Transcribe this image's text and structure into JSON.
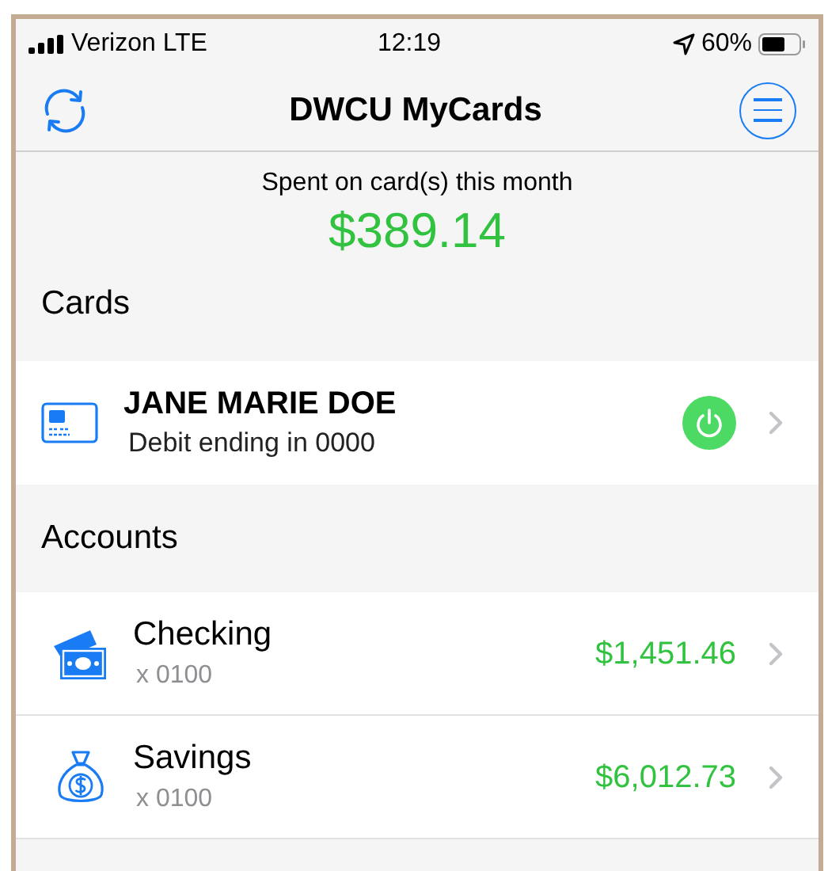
{
  "status_bar": {
    "carrier": "Verizon LTE",
    "time": "12:19",
    "battery": "60%"
  },
  "nav": {
    "title": "DWCU MyCards"
  },
  "summary": {
    "label": "Spent on card(s) this month",
    "amount": "$389.14"
  },
  "cards_section": {
    "title": "Cards",
    "cards": [
      {
        "name": "JANE MARIE DOE",
        "detail": "Debit ending in 0000",
        "on": true
      }
    ]
  },
  "accounts_section": {
    "title": "Accounts",
    "accounts": [
      {
        "kind": "checking",
        "name": "Checking",
        "number": "x 0100",
        "balance": "$1,451.46"
      },
      {
        "kind": "savings",
        "name": "Savings",
        "number": "x 0100",
        "balance": "$6,012.73"
      }
    ]
  }
}
